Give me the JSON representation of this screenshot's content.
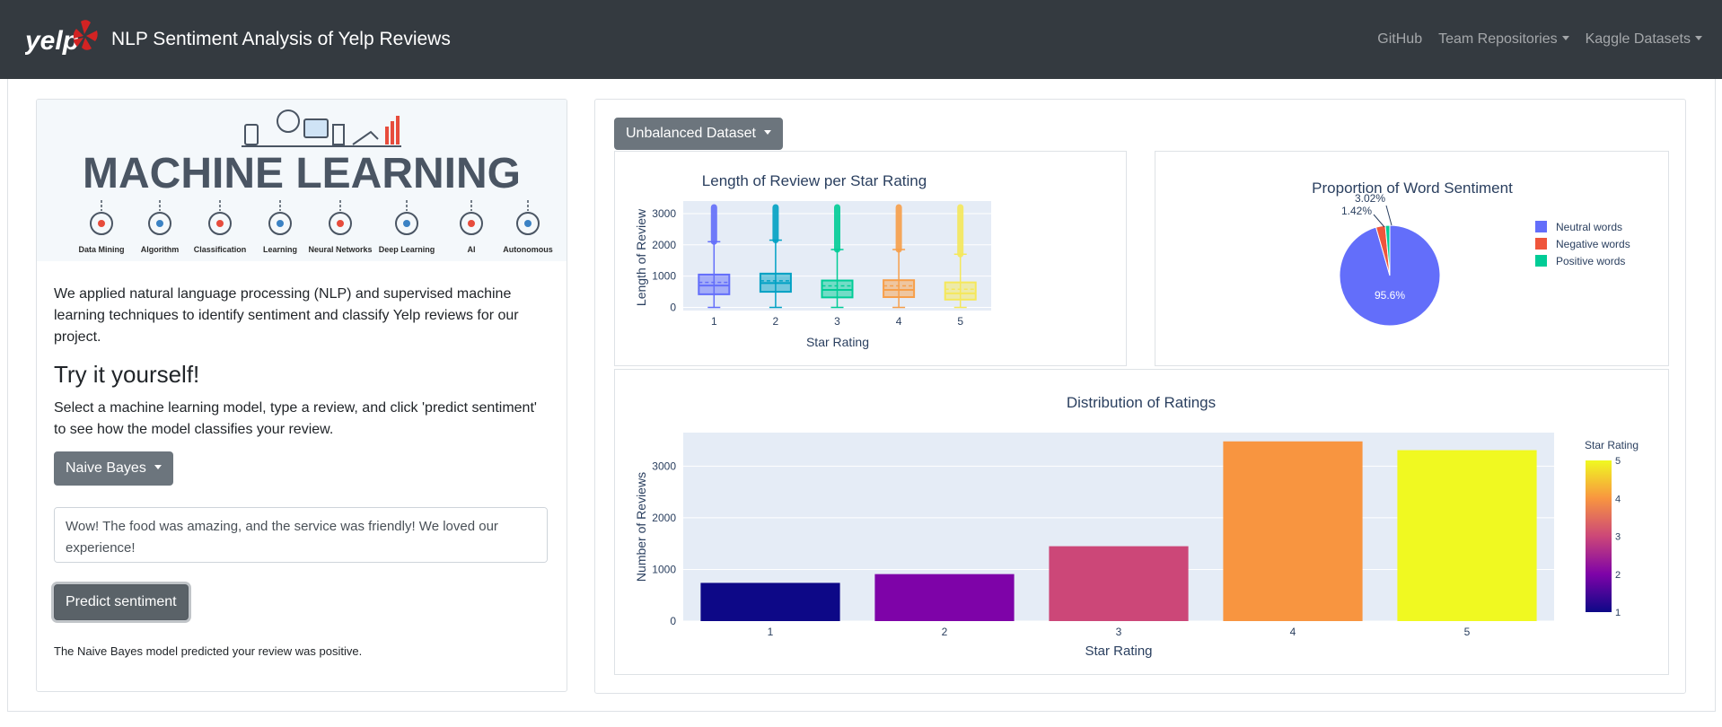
{
  "navbar": {
    "logo_text": "yelp",
    "title": "NLP Sentiment Analysis of Yelp Reviews",
    "links": {
      "github": "GitHub",
      "team": "Team Repositories",
      "kaggle": "Kaggle Datasets"
    }
  },
  "left": {
    "banner": {
      "title": "MACHINE LEARNING",
      "items": [
        "Data Mining",
        "Algorithm",
        "Classification",
        "Learning",
        "Neural Networks",
        "Deep Learning",
        "AI",
        "Autonomous"
      ]
    },
    "intro": "We applied natural language processing (NLP) and supervised machine learning techniques to identify sentiment and classify Yelp reviews for our project.",
    "try_title": "Try it yourself!",
    "try_text": "Select a machine learning model, type a review, and click 'predict sentiment' to see how the model classifies your review.",
    "model_select": "Naive Bayes",
    "review_text": "Wow! The food was amazing, and the service was friendly! We loved our experience!",
    "predict_label": "Predict sentiment",
    "result": "The Naive Bayes model predicted your review was positive."
  },
  "right": {
    "dataset_select": "Unbalanced Dataset"
  },
  "chart_data": [
    {
      "type": "box",
      "title": "Length of Review per Star Rating",
      "xlabel": "Star Rating",
      "ylabel": "Length of Review",
      "categories": [
        "1",
        "2",
        "3",
        "4",
        "5"
      ],
      "yticks": [
        "0",
        "1000",
        "2000",
        "3000"
      ],
      "ylim": [
        -100,
        3400
      ],
      "colors": [
        "#636efa",
        "#00a1c4",
        "#00cc96",
        "#f79f4a",
        "#f5e85a"
      ],
      "q1": [
        420,
        500,
        320,
        330,
        250
      ],
      "median": [
        700,
        780,
        560,
        560,
        450
      ],
      "mean": [
        800,
        850,
        690,
        690,
        580
      ],
      "q3": [
        1050,
        1080,
        860,
        870,
        800
      ],
      "whisker_high": [
        2100,
        2150,
        1850,
        1850,
        1700
      ],
      "max": [
        3200,
        3200,
        3200,
        3200,
        3200
      ]
    },
    {
      "type": "pie",
      "title": "Proportion of Word Sentiment",
      "labels": [
        "Neutral words",
        "Negative words",
        "Positive words"
      ],
      "values": [
        95.6,
        3.02,
        1.42
      ],
      "value_labels": [
        "95.6%",
        "3.02%",
        "1.42%"
      ],
      "colors": [
        "#636efa",
        "#ef553b",
        "#00cc96"
      ],
      "legend": "right"
    },
    {
      "type": "bar",
      "title": "Distribution of Ratings",
      "xlabel": "Star Rating",
      "ylabel": "Number of Reviews",
      "categories": [
        "1",
        "2",
        "3",
        "4",
        "5"
      ],
      "values": [
        740,
        910,
        1450,
        3480,
        3310
      ],
      "colors": [
        "#0d0887",
        "#7e03a8",
        "#cc4778",
        "#f89540",
        "#f0f921"
      ],
      "yticks": [
        "0",
        "1000",
        "2000",
        "3000"
      ],
      "ylim": [
        0,
        3650
      ],
      "colorbar": {
        "title": "Star Rating",
        "ticks": [
          "1",
          "2",
          "3",
          "4",
          "5"
        ]
      }
    }
  ]
}
